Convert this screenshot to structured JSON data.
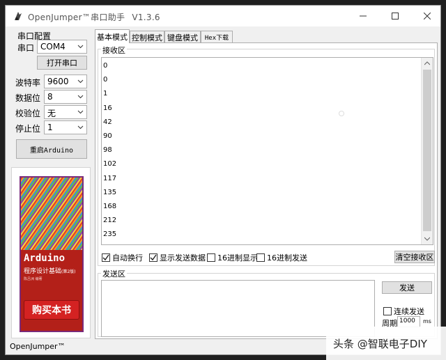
{
  "window": {
    "title": "OpenJumper™串口助手",
    "version": "V1.3.6",
    "minimize_icon": "minimize-icon",
    "maximize_icon": "maximize-icon",
    "close_icon": "close-icon"
  },
  "serial_config": {
    "group_label": "串口配置",
    "port_label": "串口",
    "port_value": "COM4",
    "open_button": "打开串口",
    "baud_label": "波特率",
    "baud_value": "9600",
    "data_bits_label": "数据位",
    "data_bits_value": "8",
    "parity_label": "校验位",
    "parity_value": "无",
    "stop_bits_label": "停止位",
    "stop_bits_value": "1",
    "restart_button": "重启Arduino"
  },
  "ad": {
    "book_title": "Arduino",
    "book_subtitle": "程序设计基础",
    "book_edition": "(第2版)",
    "book_author": "陈吕洲 编著",
    "buy_button": "购买本书"
  },
  "tabs": [
    "基本模式",
    "控制模式",
    "键盘模式",
    "Hex下载"
  ],
  "receive": {
    "group_label": "接收区",
    "lines": [
      "0",
      "0",
      "1",
      "16",
      "42",
      "90",
      "98",
      "102",
      "117",
      "135",
      "168",
      "212",
      "235"
    ],
    "options": {
      "auto_newline": {
        "label": "自动换行",
        "checked": true
      },
      "show_sent": {
        "label": "显示发送数据",
        "checked": true
      },
      "hex_display": {
        "label": "16进制显示",
        "checked": false
      },
      "hex_send": {
        "label": "16进制发送",
        "checked": false
      }
    },
    "clear_button": "清空接收区"
  },
  "send": {
    "group_label": "发送区",
    "send_button": "发送",
    "continuous_label": "连续发送",
    "continuous_checked": false,
    "period_label": "周期",
    "period_value": "1000",
    "period_unit": "ms"
  },
  "status_bar": {
    "text": "OpenJumper™"
  },
  "watermark": {
    "text": "头条 @智联电子DIY"
  },
  "colors": {
    "window_bg": "#f0f0f0",
    "buy_button": "#d42222",
    "book_cover": "#b32019"
  }
}
